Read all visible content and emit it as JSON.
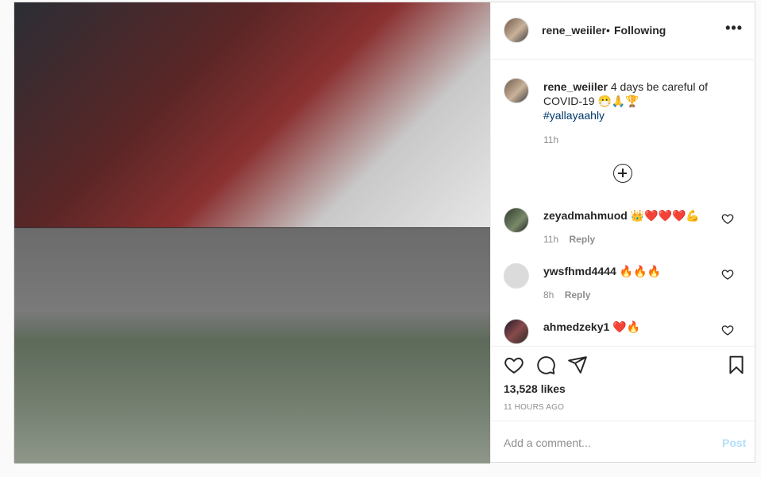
{
  "post": {
    "username": "rene_weiiler",
    "separator": "•",
    "follow_status": "Following",
    "more_icon": "more-horizontal-icon",
    "caption": {
      "username": "rene_weiiler",
      "text": "4 days be careful of COVID-19 😷🙏🏆",
      "hashtag": "#yallayaahly",
      "time": "11h"
    },
    "comments": [
      {
        "username": "zeyadmahmuod",
        "text": "👑❤️❤️❤️💪",
        "time": "11h",
        "reply": "Reply"
      },
      {
        "username": "ywsfhmd4444",
        "text": "🔥🔥🔥",
        "time": "8h",
        "reply": "Reply"
      },
      {
        "username": "ahmedzeky1",
        "text": "❤️🔥",
        "time": "",
        "reply": ""
      }
    ],
    "likes": "13,528 likes",
    "posted": "11 HOURS AGO",
    "add_comment_placeholder": "Add a comment...",
    "post_button": "Post"
  },
  "colors": {
    "link": "#00376b",
    "secondary_text": "#8e8e8e",
    "post_button_disabled": "#b2dffc"
  }
}
